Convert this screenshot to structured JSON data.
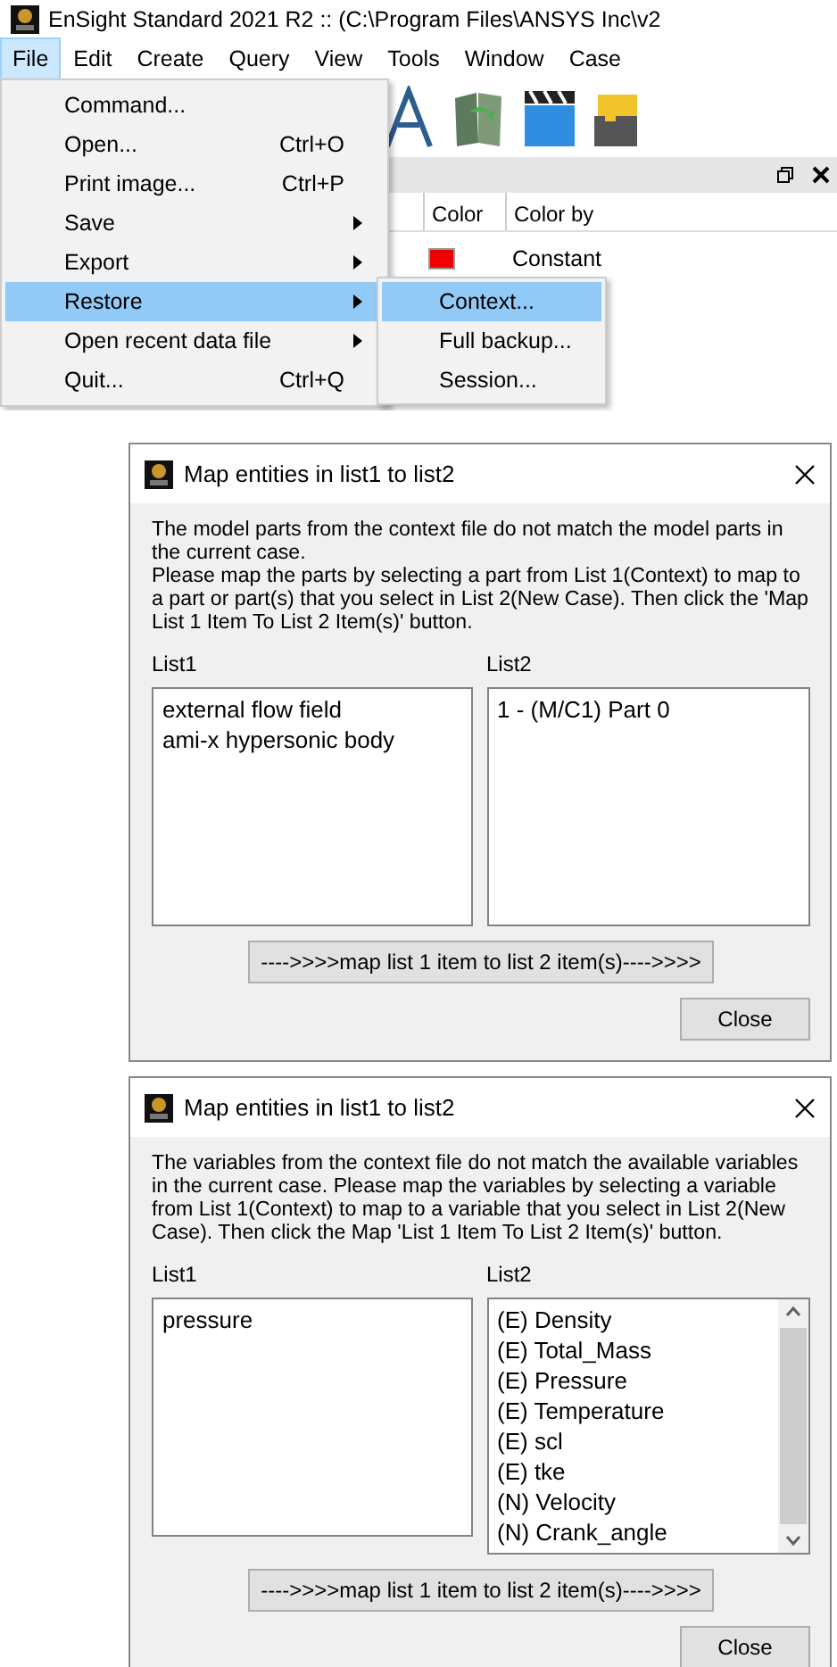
{
  "app_window": {
    "title": "EnSight Standard 2021 R2 ::  (C:\\Program Files\\ANSYS Inc\\v2",
    "menu_bar": [
      {
        "label": "File",
        "selected": true
      },
      {
        "label": "Edit",
        "selected": false
      },
      {
        "label": "Create",
        "selected": false
      },
      {
        "label": "Query",
        "selected": false
      },
      {
        "label": "View",
        "selected": false
      },
      {
        "label": "Tools",
        "selected": false
      },
      {
        "label": "Window",
        "selected": false
      },
      {
        "label": "Case",
        "selected": false
      }
    ],
    "parts_panel": {
      "columns": [
        "Color",
        "Color by"
      ],
      "rows": [
        {
          "color": "#ee0000",
          "color_by": "Constant"
        }
      ]
    }
  },
  "file_menu": [
    {
      "label": "Command...",
      "kind": "item",
      "selected": false
    },
    {
      "label": "Open...",
      "shortcut": "Ctrl+O",
      "kind": "item",
      "selected": false
    },
    {
      "label": "Print image...",
      "shortcut": "Ctrl+P",
      "kind": "item",
      "selected": false
    },
    {
      "label": "Save",
      "kind": "submenu",
      "selected": false
    },
    {
      "label": "Export",
      "kind": "submenu",
      "selected": false
    },
    {
      "label": "Restore",
      "kind": "submenu",
      "selected": true
    },
    {
      "label": "Open recent data file",
      "kind": "submenu",
      "selected": false
    },
    {
      "label": "Quit...",
      "shortcut": "Ctrl+Q",
      "kind": "item",
      "selected": false
    }
  ],
  "restore_submenu": [
    {
      "label": "Context...",
      "selected": true
    },
    {
      "label": "Full backup...",
      "selected": false
    },
    {
      "label": "Session...",
      "selected": false
    }
  ],
  "dialogs": [
    {
      "title": "Map entities in list1 to list2",
      "message": [
        "The model parts from the context file do not match the model parts in the current case.",
        "Please map the parts by selecting a part from List 1(Context) to map to a part or part(s) that you select in List 2(New Case).  Then click the 'Map List 1 Item To List 2 Item(s)' button."
      ],
      "list1_label": "List1",
      "list2_label": "List2",
      "list1_items": [
        "external flow field",
        "ami-x hypersonic body"
      ],
      "list2_items": [
        "1 - (M/C1) Part 0"
      ],
      "list2_scrollbar": false,
      "map_button": "---->>>>map list 1 item to list 2 item(s)---->>>>",
      "close_button": "Close"
    },
    {
      "title": "Map entities in list1 to list2",
      "message": [
        "The variables from the context file do not match the available variables in the current case.  Please map the variables by selecting a variable from List 1(Context) to map to a variable that you select in List 2(New Case).  Then click the Map 'List 1 Item To List 2 Item(s)' button."
      ],
      "list1_label": "List1",
      "list2_label": "List2",
      "list1_items": [
        "pressure"
      ],
      "list2_items": [
        "(E) Density",
        "(E) Total_Mass",
        "(E) Pressure",
        "(E) Temperature",
        "(E) scl",
        "(E) tke",
        "(N) Velocity",
        "(N) Crank_angle"
      ],
      "list2_scrollbar": true,
      "map_button": "---->>>>map list 1 item to list 2 item(s)---->>>>",
      "close_button": "Close"
    }
  ]
}
